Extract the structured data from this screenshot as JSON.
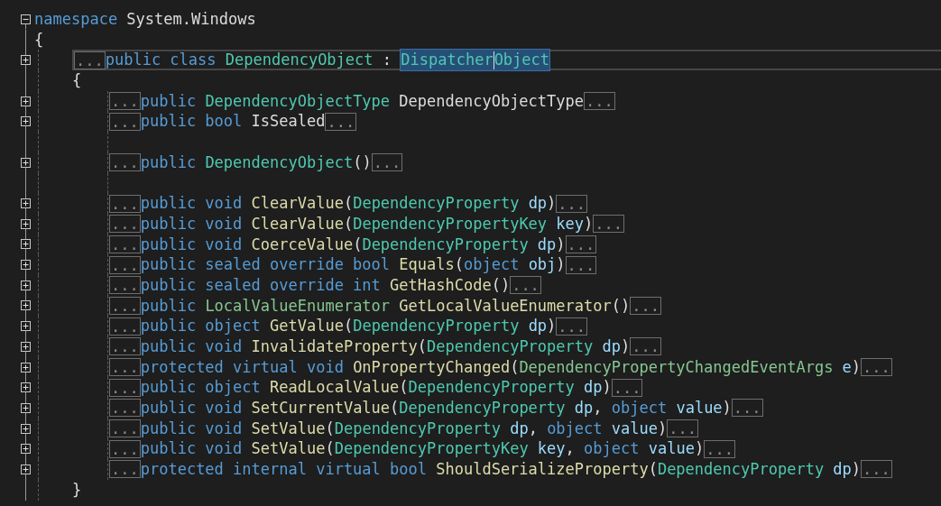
{
  "editor": {
    "lines": [
      {
        "kind": "code",
        "expanded": true,
        "tokens": [
          {
            "kind": "keyword",
            "text": "namespace "
          },
          {
            "kind": "plain",
            "text": "System.Windows"
          }
        ]
      },
      {
        "kind": "code",
        "tokens": [
          {
            "kind": "plain",
            "text": "{"
          }
        ],
        "children": [
          {
            "kind": "code",
            "expanded": false,
            "current_line": true,
            "comment_stub": "...",
            "tokens": [
              {
                "kind": "keyword",
                "text": "public class "
              },
              {
                "kind": "type",
                "text": "DependencyObject"
              },
              {
                "kind": "plain",
                "text": " : "
              },
              {
                "kind": "type",
                "text": "Dispatcher",
                "selected": true,
                "caret": true
              },
              {
                "kind": "type",
                "text": "Object",
                "selected": true
              }
            ]
          },
          {
            "kind": "code",
            "tokens": [
              {
                "kind": "plain",
                "text": "{"
              }
            ],
            "children": [
              {
                "kind": "code",
                "expanded": false,
                "comment_stub": "...",
                "body_stub": "...",
                "tokens": [
                  {
                    "kind": "keyword",
                    "text": "public "
                  },
                  {
                    "kind": "type",
                    "text": "DependencyObjectType"
                  },
                  {
                    "kind": "plain",
                    "text": " DependencyObjectType"
                  }
                ]
              },
              {
                "kind": "code",
                "expanded": false,
                "comment_stub": "...",
                "body_stub": "...",
                "tokens": [
                  {
                    "kind": "keyword",
                    "text": "public bool "
                  },
                  {
                    "kind": "plain",
                    "text": "IsSealed"
                  }
                ]
              },
              {
                "kind": "blank"
              },
              {
                "kind": "code",
                "expanded": false,
                "comment_stub": "...",
                "body_stub": "...",
                "tokens": [
                  {
                    "kind": "keyword",
                    "text": "public "
                  },
                  {
                    "kind": "type",
                    "text": "DependencyObject"
                  },
                  {
                    "kind": "plain",
                    "text": "()"
                  }
                ]
              },
              {
                "kind": "blank"
              },
              {
                "kind": "code",
                "expanded": false,
                "comment_stub": "...",
                "body_stub": "...",
                "tokens": [
                  {
                    "kind": "keyword",
                    "text": "public void "
                  },
                  {
                    "kind": "method",
                    "text": "ClearValue"
                  },
                  {
                    "kind": "plain",
                    "text": "("
                  },
                  {
                    "kind": "type",
                    "text": "DependencyProperty "
                  },
                  {
                    "kind": "param",
                    "text": "dp"
                  },
                  {
                    "kind": "plain",
                    "text": ")"
                  }
                ]
              },
              {
                "kind": "code",
                "expanded": false,
                "comment_stub": "...",
                "body_stub": "...",
                "tokens": [
                  {
                    "kind": "keyword",
                    "text": "public void "
                  },
                  {
                    "kind": "method",
                    "text": "ClearValue"
                  },
                  {
                    "kind": "plain",
                    "text": "("
                  },
                  {
                    "kind": "type",
                    "text": "DependencyPropertyKey "
                  },
                  {
                    "kind": "param",
                    "text": "key"
                  },
                  {
                    "kind": "plain",
                    "text": ")"
                  }
                ]
              },
              {
                "kind": "code",
                "expanded": false,
                "comment_stub": "...",
                "body_stub": "...",
                "tokens": [
                  {
                    "kind": "keyword",
                    "text": "public void "
                  },
                  {
                    "kind": "method",
                    "text": "CoerceValue"
                  },
                  {
                    "kind": "plain",
                    "text": "("
                  },
                  {
                    "kind": "type",
                    "text": "DependencyProperty "
                  },
                  {
                    "kind": "param",
                    "text": "dp"
                  },
                  {
                    "kind": "plain",
                    "text": ")"
                  }
                ]
              },
              {
                "kind": "code",
                "expanded": false,
                "comment_stub": "...",
                "body_stub": "...",
                "tokens": [
                  {
                    "kind": "keyword",
                    "text": "public sealed override bool "
                  },
                  {
                    "kind": "method",
                    "text": "Equals"
                  },
                  {
                    "kind": "plain",
                    "text": "("
                  },
                  {
                    "kind": "keyword",
                    "text": "object "
                  },
                  {
                    "kind": "param",
                    "text": "obj"
                  },
                  {
                    "kind": "plain",
                    "text": ")"
                  }
                ]
              },
              {
                "kind": "code",
                "expanded": false,
                "comment_stub": "...",
                "body_stub": "...",
                "tokens": [
                  {
                    "kind": "keyword",
                    "text": "public sealed override int "
                  },
                  {
                    "kind": "method",
                    "text": "GetHashCode"
                  },
                  {
                    "kind": "plain",
                    "text": "()"
                  }
                ]
              },
              {
                "kind": "code",
                "expanded": false,
                "comment_stub": "...",
                "body_stub": "...",
                "tokens": [
                  {
                    "kind": "keyword",
                    "text": "public "
                  },
                  {
                    "kind": "struct",
                    "text": "LocalValueEnumerator "
                  },
                  {
                    "kind": "method",
                    "text": "GetLocalValueEnumerator"
                  },
                  {
                    "kind": "plain",
                    "text": "()"
                  }
                ]
              },
              {
                "kind": "code",
                "expanded": false,
                "comment_stub": "...",
                "body_stub": "...",
                "tokens": [
                  {
                    "kind": "keyword",
                    "text": "public object "
                  },
                  {
                    "kind": "method",
                    "text": "GetValue"
                  },
                  {
                    "kind": "plain",
                    "text": "("
                  },
                  {
                    "kind": "type",
                    "text": "DependencyProperty "
                  },
                  {
                    "kind": "param",
                    "text": "dp"
                  },
                  {
                    "kind": "plain",
                    "text": ")"
                  }
                ]
              },
              {
                "kind": "code",
                "expanded": false,
                "comment_stub": "...",
                "body_stub": "...",
                "tokens": [
                  {
                    "kind": "keyword",
                    "text": "public void "
                  },
                  {
                    "kind": "method",
                    "text": "InvalidateProperty"
                  },
                  {
                    "kind": "plain",
                    "text": "("
                  },
                  {
                    "kind": "type",
                    "text": "DependencyProperty "
                  },
                  {
                    "kind": "param",
                    "text": "dp"
                  },
                  {
                    "kind": "plain",
                    "text": ")"
                  }
                ]
              },
              {
                "kind": "code",
                "expanded": false,
                "comment_stub": "...",
                "body_stub": "...",
                "tokens": [
                  {
                    "kind": "keyword",
                    "text": "protected virtual void "
                  },
                  {
                    "kind": "method",
                    "text": "OnPropertyChanged"
                  },
                  {
                    "kind": "plain",
                    "text": "("
                  },
                  {
                    "kind": "struct",
                    "text": "DependencyPropertyChangedEventArgs "
                  },
                  {
                    "kind": "param",
                    "text": "e"
                  },
                  {
                    "kind": "plain",
                    "text": ")"
                  }
                ]
              },
              {
                "kind": "code",
                "expanded": false,
                "comment_stub": "...",
                "body_stub": "...",
                "tokens": [
                  {
                    "kind": "keyword",
                    "text": "public object "
                  },
                  {
                    "kind": "method",
                    "text": "ReadLocalValue"
                  },
                  {
                    "kind": "plain",
                    "text": "("
                  },
                  {
                    "kind": "type",
                    "text": "DependencyProperty "
                  },
                  {
                    "kind": "param",
                    "text": "dp"
                  },
                  {
                    "kind": "plain",
                    "text": ")"
                  }
                ]
              },
              {
                "kind": "code",
                "expanded": false,
                "comment_stub": "...",
                "body_stub": "...",
                "tokens": [
                  {
                    "kind": "keyword",
                    "text": "public void "
                  },
                  {
                    "kind": "method",
                    "text": "SetCurrentValue"
                  },
                  {
                    "kind": "plain",
                    "text": "("
                  },
                  {
                    "kind": "type",
                    "text": "DependencyProperty "
                  },
                  {
                    "kind": "param",
                    "text": "dp"
                  },
                  {
                    "kind": "plain",
                    "text": ", "
                  },
                  {
                    "kind": "keyword",
                    "text": "object "
                  },
                  {
                    "kind": "param",
                    "text": "value"
                  },
                  {
                    "kind": "plain",
                    "text": ")"
                  }
                ]
              },
              {
                "kind": "code",
                "expanded": false,
                "comment_stub": "...",
                "body_stub": "...",
                "tokens": [
                  {
                    "kind": "keyword",
                    "text": "public void "
                  },
                  {
                    "kind": "method",
                    "text": "SetValue"
                  },
                  {
                    "kind": "plain",
                    "text": "("
                  },
                  {
                    "kind": "type",
                    "text": "DependencyProperty "
                  },
                  {
                    "kind": "param",
                    "text": "dp"
                  },
                  {
                    "kind": "plain",
                    "text": ", "
                  },
                  {
                    "kind": "keyword",
                    "text": "object "
                  },
                  {
                    "kind": "param",
                    "text": "value"
                  },
                  {
                    "kind": "plain",
                    "text": ")"
                  }
                ]
              },
              {
                "kind": "code",
                "expanded": false,
                "comment_stub": "...",
                "body_stub": "...",
                "tokens": [
                  {
                    "kind": "keyword",
                    "text": "public void "
                  },
                  {
                    "kind": "method",
                    "text": "SetValue"
                  },
                  {
                    "kind": "plain",
                    "text": "("
                  },
                  {
                    "kind": "type",
                    "text": "DependencyPropertyKey "
                  },
                  {
                    "kind": "param",
                    "text": "key"
                  },
                  {
                    "kind": "plain",
                    "text": ", "
                  },
                  {
                    "kind": "keyword",
                    "text": "object "
                  },
                  {
                    "kind": "param",
                    "text": "value"
                  },
                  {
                    "kind": "plain",
                    "text": ")"
                  }
                ]
              },
              {
                "kind": "code",
                "expanded": false,
                "comment_stub": "...",
                "body_stub": "...",
                "tokens": [
                  {
                    "kind": "keyword",
                    "text": "protected internal virtual bool "
                  },
                  {
                    "kind": "method",
                    "text": "ShouldSerializeProperty"
                  },
                  {
                    "kind": "plain",
                    "text": "("
                  },
                  {
                    "kind": "type",
                    "text": "DependencyProperty "
                  },
                  {
                    "kind": "param",
                    "text": "dp"
                  },
                  {
                    "kind": "plain",
                    "text": ")"
                  }
                ]
              }
            ]
          },
          {
            "kind": "code",
            "tokens": [
              {
                "kind": "plain",
                "text": "}"
              }
            ]
          }
        ]
      }
    ]
  }
}
